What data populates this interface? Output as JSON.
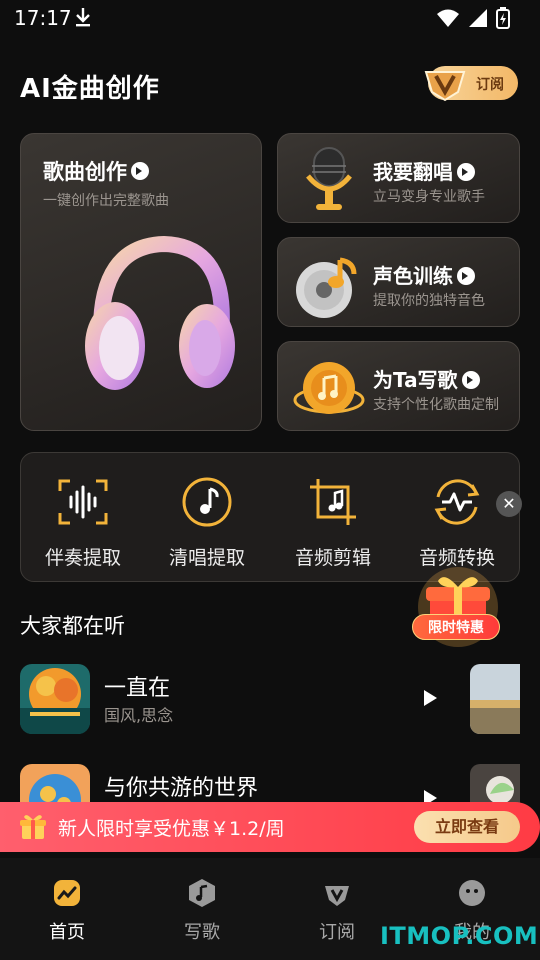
{
  "status": {
    "time": "17:17"
  },
  "header": {
    "title": "AI金曲创作",
    "subscribe_label": "订阅"
  },
  "cards": {
    "main": {
      "title": "歌曲创作",
      "subtitle": "一键创作出完整歌曲"
    },
    "cover": {
      "title": "我要翻唱",
      "subtitle": "立马变身专业歌手"
    },
    "voice": {
      "title": "声色训练",
      "subtitle": "提取你的独特音色"
    },
    "write": {
      "title": "为Ta写歌",
      "subtitle": "支持个性化歌曲定制"
    }
  },
  "tools": [
    {
      "label": "伴奏提取"
    },
    {
      "label": "清唱提取"
    },
    {
      "label": "音频剪辑"
    },
    {
      "label": "音频转换"
    }
  ],
  "promo": {
    "tag": "限时特惠"
  },
  "section": {
    "title": "大家都在听"
  },
  "songs": [
    {
      "title": "一直在",
      "tags": "国风,思念"
    },
    {
      "title": "与你共游的世界",
      "tags": ""
    }
  ],
  "banner": {
    "text": "新人限时享受优惠￥1.2/周",
    "button": "立即查看"
  },
  "nav": [
    {
      "label": "首页",
      "icon": "home-icon",
      "active": true
    },
    {
      "label": "写歌",
      "icon": "music-note-icon",
      "active": false
    },
    {
      "label": "订阅",
      "icon": "vip-icon",
      "active": false
    },
    {
      "label": "我的",
      "icon": "profile-icon",
      "active": false
    }
  ],
  "watermark": "ITMOP.COM",
  "colors": {
    "background": "#0e0e0e",
    "accent": "#f3b867",
    "banner": "#ff4b55"
  }
}
